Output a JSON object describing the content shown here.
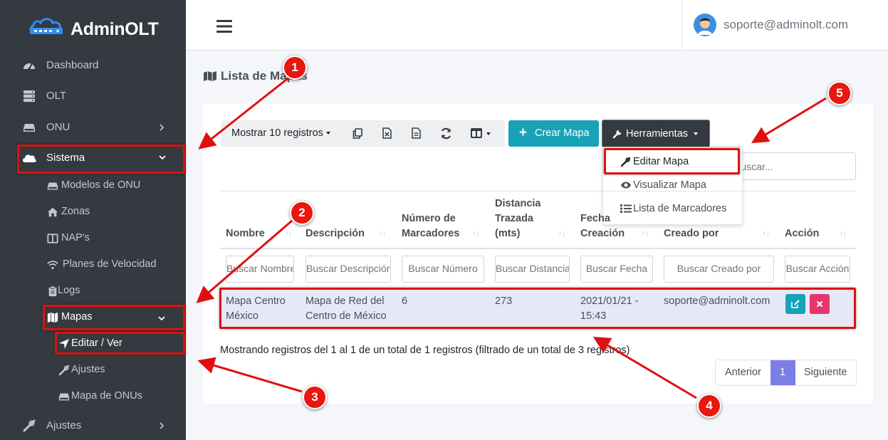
{
  "brand": {
    "name": "AdminOLT"
  },
  "sidebar": {
    "items": [
      {
        "label": "Dashboard"
      },
      {
        "label": "OLT"
      },
      {
        "label": "ONU"
      },
      {
        "label": "Sistema"
      },
      {
        "label": "Ajustes"
      }
    ],
    "sistema_sub": [
      {
        "label": "Modelos de ONU"
      },
      {
        "label": "Zonas"
      },
      {
        "label": "NAP's"
      },
      {
        "label": "Planes de Velocidad"
      },
      {
        "label": "Logs"
      },
      {
        "label": "Mapas"
      }
    ],
    "mapas_sub": [
      {
        "label": "Editar / Ver"
      },
      {
        "label": "Ajustes"
      },
      {
        "label": "Mapa de ONUs"
      }
    ]
  },
  "topbar": {
    "user_email": "soporte@adminolt.com"
  },
  "page": {
    "title": "Lista de Mapas"
  },
  "toolbar": {
    "show_records": "Mostrar 10 registros",
    "create_label": "Crear Mapa",
    "tools_label": "Herramientas"
  },
  "tools_menu": [
    {
      "label": "Editar Mapa"
    },
    {
      "label": "Visualizar Mapa"
    },
    {
      "label": "Lista de Marcadores"
    }
  ],
  "search": {
    "placeholder": "Buscar..."
  },
  "table": {
    "columns": [
      {
        "line1": "Nombre"
      },
      {
        "line1": "Descripción"
      },
      {
        "line1": "Número de",
        "line2": "Marcadores"
      },
      {
        "line1": "Distancia",
        "line2": "Trazada",
        "line3": "(mts)"
      },
      {
        "line1": "Fecha",
        "line2": "Creación"
      },
      {
        "line1": "Creado por"
      },
      {
        "line1": "Acción"
      }
    ],
    "filters": [
      "Buscar Nombre",
      "Buscar Descripción",
      "Buscar Número",
      "Buscar Distancia",
      "Buscar Fecha",
      "Buscar Creado por",
      "Buscar Acción"
    ],
    "rows": [
      {
        "nombre_1": "Mapa Centro",
        "nombre_2": "México",
        "desc_1": "Mapa de Red del",
        "desc_2": "Centro de México",
        "marcadores": "6",
        "distancia": "273",
        "fecha_1": "2021/01/21 -",
        "fecha_2": "15:43",
        "creado_por": "soporte@adminolt.com"
      }
    ]
  },
  "table_info": "Mostrando registros del 1 al 1 de un total de 1 registros (filtrado de un total de 3 registros)",
  "pagination": {
    "prev": "Anterior",
    "current": "1",
    "next": "Siguiente"
  },
  "annotations": [
    "1",
    "2",
    "3",
    "4",
    "5"
  ],
  "colors": {
    "sidebar": "#343a40",
    "info": "#17a2b8",
    "danger": "#e8356b",
    "highlight": "#e01010",
    "pager_active": "#7c7ee8"
  }
}
